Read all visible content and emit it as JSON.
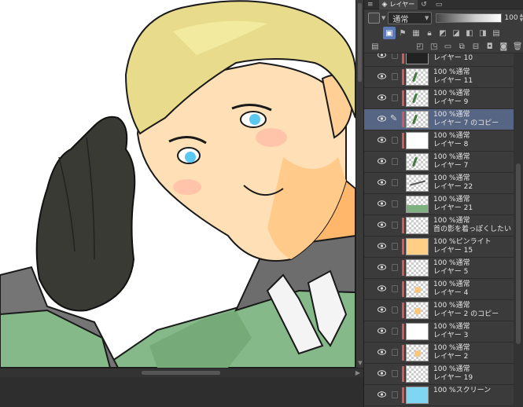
{
  "panel": {
    "tabs": [
      {
        "label": "",
        "icon": "menu-icon"
      },
      {
        "label": "レイヤー",
        "icon": "layers-icon"
      },
      {
        "label": "",
        "icon": "history-icon"
      },
      {
        "label": "",
        "icon": "navigator-icon"
      }
    ],
    "blend_mode": "通常",
    "opacity_value": "100",
    "toolbar_icons": [
      "clip-icon",
      "reference-icon",
      "lock-transparent-icon",
      "lock-icon",
      "mask-enable-icon",
      "mask-show-icon",
      "layer-color-icon",
      "color-picker-icon",
      "palette-icon",
      "draft-icon"
    ],
    "footer_icons": [
      "new-raster-icon",
      "new-vector-icon",
      "new-folder-icon",
      "transfer-down-icon",
      "merge-icon",
      "mask-add-icon",
      "mask-apply-icon",
      "delete-icon"
    ]
  },
  "layers": [
    {
      "mode": "",
      "name": "レイヤー 10",
      "tag": "#d8585a",
      "thumb": "dark",
      "selected": false,
      "partial": true
    },
    {
      "mode": "100 %通常",
      "name": "レイヤー 11",
      "tag": "#d8585a",
      "thumb": "green-stroke",
      "selected": false
    },
    {
      "mode": "100 %通常",
      "name": "レイヤー 9",
      "tag": "#d8585a",
      "thumb": "green-stroke",
      "selected": false
    },
    {
      "mode": "100 %通常",
      "name": "レイヤー 7 のコピー",
      "tag": "#d8585a",
      "thumb": "green-stroke",
      "selected": true
    },
    {
      "mode": "100 %通常",
      "name": "レイヤー 8",
      "tag": "#d8585a",
      "thumb": "white",
      "selected": false
    },
    {
      "mode": "100 %通常",
      "name": "レイヤー 7",
      "tag": "",
      "thumb": "green-stroke",
      "selected": false
    },
    {
      "mode": "100 %通常",
      "name": "レイヤー 22",
      "tag": "",
      "thumb": "sketch",
      "selected": false
    },
    {
      "mode": "100 %通常",
      "name": "レイヤー 21",
      "tag": "",
      "thumb": "green-fill",
      "selected": false
    },
    {
      "mode": "100 %通常",
      "name": "首の影を着っぽくしたい",
      "tag": "#d8585a",
      "thumb": "transparent",
      "selected": false
    },
    {
      "mode": "100 %ピンライト",
      "name": "レイヤー 15",
      "tag": "#d8585a",
      "thumb": "orange",
      "selected": false
    },
    {
      "mode": "100 %通常",
      "name": "レイヤー 5",
      "tag": "#d8585a",
      "thumb": "transparent",
      "selected": false
    },
    {
      "mode": "100 %通常",
      "name": "レイヤー 4",
      "tag": "#d8585a",
      "thumb": "skin-dots",
      "selected": false
    },
    {
      "mode": "100 %通常",
      "name": "レイヤー 2 のコピー",
      "tag": "#d8585a",
      "thumb": "skin-dot",
      "selected": false
    },
    {
      "mode": "100 %通常",
      "name": "レイヤー 3",
      "tag": "#d8585a",
      "thumb": "white",
      "selected": false
    },
    {
      "mode": "100 %通常",
      "name": "レイヤー 2",
      "tag": "#d8585a",
      "thumb": "skin-dot",
      "selected": false
    },
    {
      "mode": "100 %通常",
      "name": "レイヤー 19",
      "tag": "#d8585a",
      "thumb": "transparent",
      "selected": false
    },
    {
      "mode": "100 %スクリーン",
      "name": "",
      "tag": "#d8585a",
      "thumb": "cyan",
      "selected": false
    }
  ]
}
